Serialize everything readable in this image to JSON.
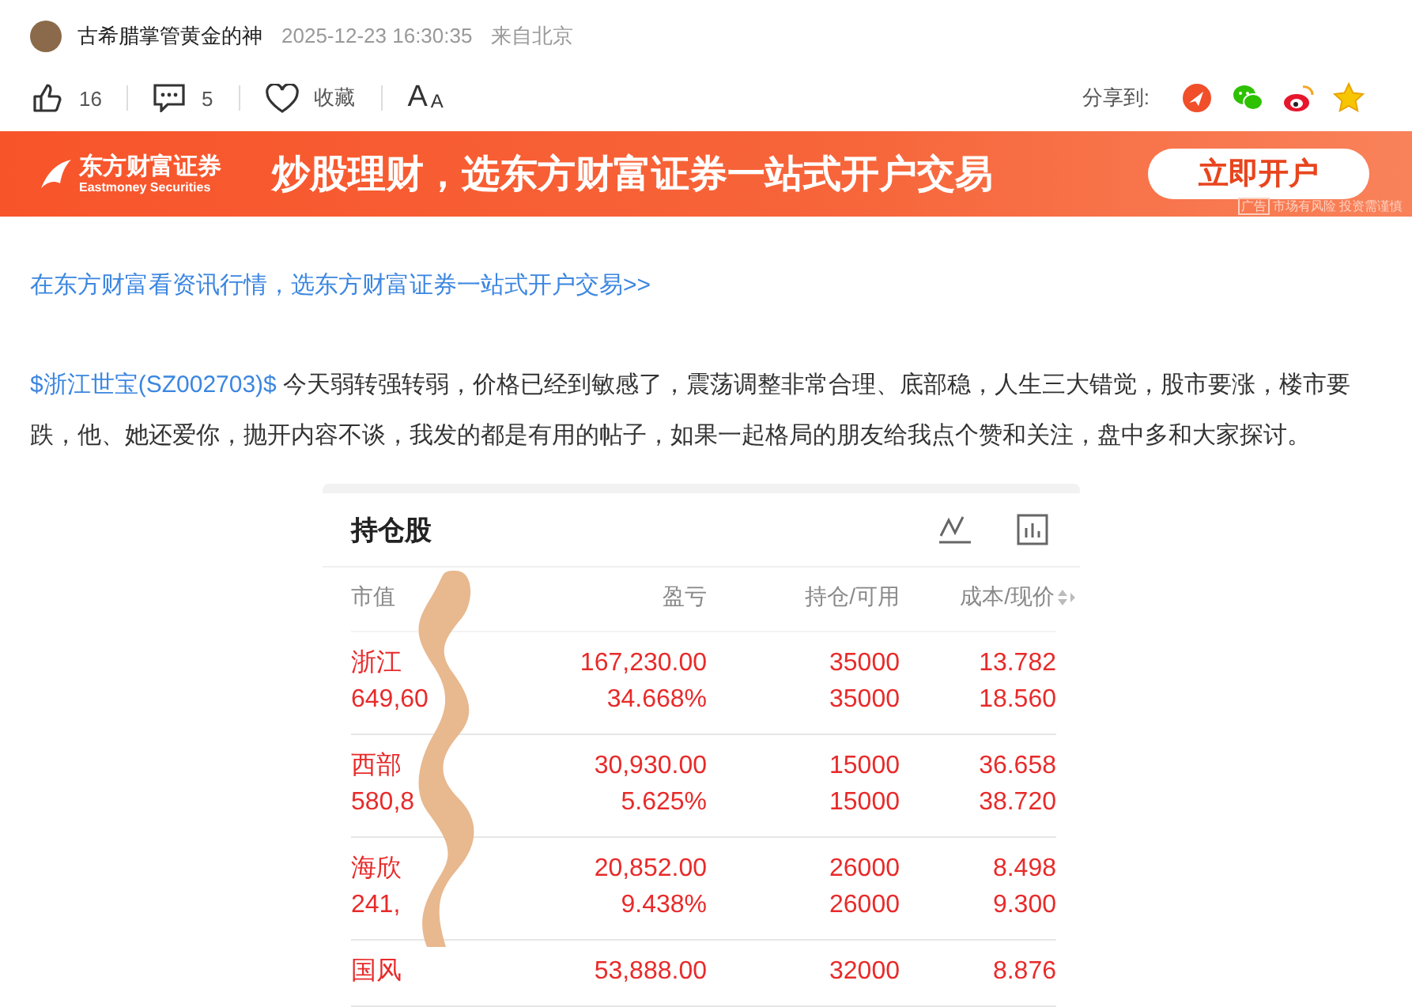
{
  "author": {
    "name": "古希腊掌管黄金的神",
    "time": "2025-12-23 16:30:35",
    "location": "来自北京"
  },
  "actions": [
    {
      "kind": "like",
      "label": "16"
    },
    {
      "kind": "comment",
      "label": "5"
    },
    {
      "kind": "favorite",
      "label": "收藏"
    },
    {
      "kind": "font",
      "label": "A",
      "small": "A"
    }
  ],
  "share": {
    "label": "分享到:",
    "targets": [
      {
        "kind": "toutiao"
      },
      {
        "kind": "wechat"
      },
      {
        "kind": "weibo"
      },
      {
        "kind": "star"
      }
    ]
  },
  "banner": {
    "brand": "东方财富证券",
    "brand_en": "Eastmoney Securities",
    "slogan": "炒股理财，选东方财富证券一站式开户交易",
    "button": "立即开户",
    "ad_tag": "广告",
    "disclaimer": "市场有风险 投资需谨慎"
  },
  "promo_link": "在东方财富看资讯行情，选东方财富证券一站式开户交易>>",
  "post": {
    "stock_link": "$浙江世宝(SZ002703)$",
    "text": " 今天弱转强转弱，价格已经到敏感了，震荡调整非常合理、底部稳，人生三大错觉，股市要涨，楼市要跌，他、她还爱你，抛开内容不谈，我发的都是有用的帖子，如果一起格局的朋友给我点个赞和关注，盘中多和大家探讨。"
  },
  "holdings": {
    "title": "持仓股",
    "columns": [
      "市值",
      "盈亏",
      "持仓/可用",
      "成本/现价"
    ],
    "rows": [
      {
        "name": "浙江",
        "value": "649,60",
        "profit": "167,230.00",
        "profit_pct": "34.668%",
        "hold": "35000",
        "avail": "35000",
        "cost": "13.782",
        "price": "18.560"
      },
      {
        "name": "西部",
        "value": "580,8",
        "profit": "30,930.00",
        "profit_pct": "5.625%",
        "hold": "15000",
        "avail": "15000",
        "cost": "36.658",
        "price": "38.720"
      },
      {
        "name": "海欣",
        "value": "241,",
        "profit": "20,852.00",
        "profit_pct": "9.438%",
        "hold": "26000",
        "avail": "26000",
        "cost": "8.498",
        "price": "9.300"
      },
      {
        "name": "国风",
        "profit": "53,888.00",
        "hold": "32000",
        "cost": "8.876"
      }
    ]
  }
}
